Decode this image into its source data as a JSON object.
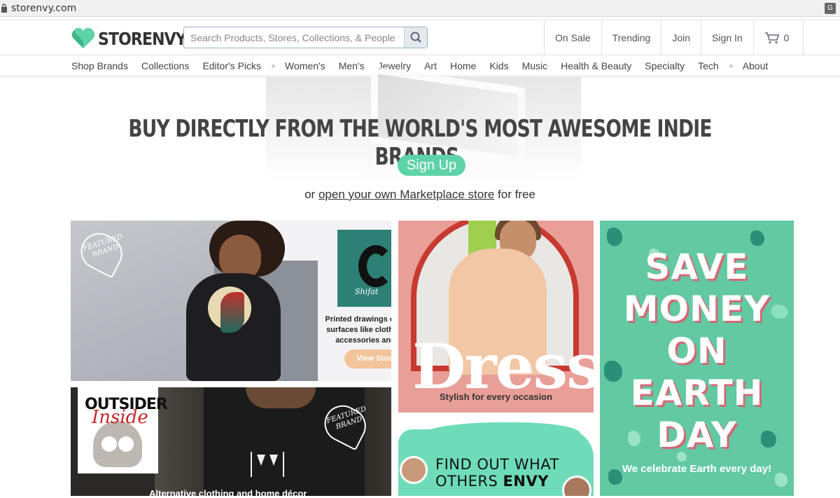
{
  "browser": {
    "url": "storenvy.com"
  },
  "header": {
    "logo_text": "STORENVY",
    "search_placeholder": "Search Products, Stores, Collections, & People",
    "nav": [
      "On Sale",
      "Trending",
      "Join",
      "Sign In"
    ],
    "cart_count": "0"
  },
  "categories": [
    "Shop Brands",
    "Collections",
    "Editor's Picks",
    "Women's",
    "Men's",
    "Jewelry",
    "Art",
    "Home",
    "Kids",
    "Music",
    "Health & Beauty",
    "Specialty",
    "Tech",
    "About"
  ],
  "hero": {
    "headline": "BUY DIRECTLY FROM THE WORLD'S MOST AWESOME INDIE BRANDS.",
    "signup_label": "Sign Up",
    "sub_prefix": "or",
    "sub_link": "open your own Marketplace store",
    "sub_suffix": "for free"
  },
  "tiles": {
    "featured1": {
      "badge": "FEATURED BRAND",
      "art_signature": "Shifat",
      "description": "Printed drawings on various surfaces like clothing, mug, accessories and more.",
      "button": "View Store"
    },
    "dress": {
      "title": "Dress",
      "caption": "Stylish for every occasion"
    },
    "earth": {
      "headline_lines": [
        "SAVE",
        "MONEY",
        "ON",
        "EARTH",
        "DAY"
      ],
      "caption": "We celebrate Earth every day!"
    },
    "featured2": {
      "badge": "FEATURED BRAND",
      "logo_top": "OUTSIDER",
      "logo_script": "Inside",
      "caption": "Alternative clothing and home décor"
    },
    "envy": {
      "line1": "FIND OUT WHAT",
      "line2_a": "OTHERS",
      "line2_b": "ENVY"
    }
  },
  "colors": {
    "brand_green": "#5ed3a8",
    "earth_bg": "#62c9a2",
    "dress_bg": "#ea9e98",
    "view_store": "#f2c49a"
  }
}
